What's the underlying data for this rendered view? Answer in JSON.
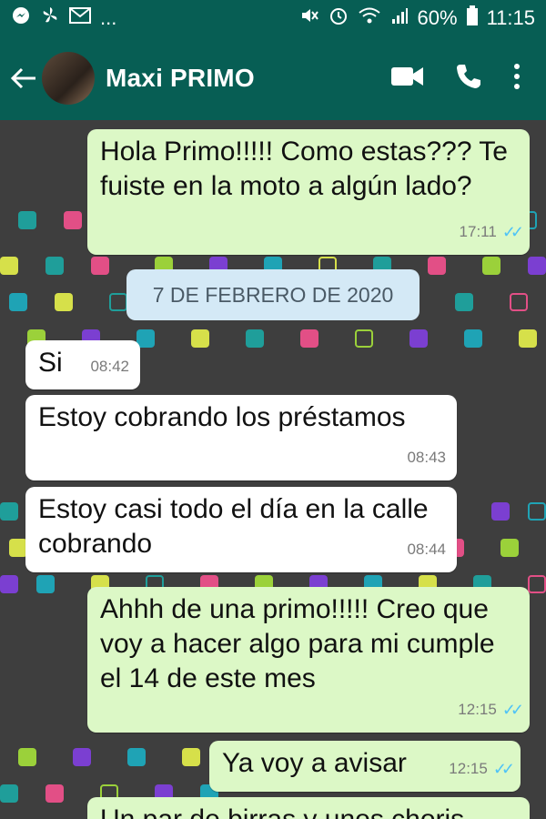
{
  "status_bar": {
    "battery": "60%",
    "clock": "11:15",
    "dots": "..."
  },
  "header": {
    "contact_name": "Maxi PRIMO"
  },
  "date_separator": "7 DE FEBRERO DE 2020",
  "messages": [
    {
      "dir": "out",
      "text": "Hola Primo!!!!! Como estas??? Te fuiste en la moto a algún lado?",
      "time": "17:11",
      "read": true
    },
    {
      "dir": "in",
      "text": "Si",
      "time": "08:42"
    },
    {
      "dir": "in",
      "text": "Estoy cobrando los préstamos",
      "time": "08:43"
    },
    {
      "dir": "in",
      "text": "Estoy casi todo el día en la calle cobrando",
      "time": "08:44"
    },
    {
      "dir": "out",
      "text": "Ahhh de una primo!!!!! Creo que voy a hacer algo para mi cumple el 14 de este mes",
      "time": "12:15",
      "read": true
    },
    {
      "dir": "out",
      "text": "Ya voy a avisar",
      "time": "12:15",
      "read": true
    },
    {
      "dir": "out",
      "text": "Un par de birras y unos choris",
      "time": "",
      "read": false
    }
  ],
  "colors": {
    "header": "#075e54",
    "outgoing_bubble": "#dcf8c6",
    "incoming_bubble": "#ffffff",
    "read_ticks": "#4fc3f7",
    "date_pill": "#d4e9f6"
  },
  "icons": [
    "messenger-icon",
    "fan-icon",
    "gmail-icon",
    "mute-icon",
    "alarm-icon",
    "wifi-icon",
    "signal-icon",
    "battery-icon",
    "back-arrow-icon",
    "video-call-icon",
    "phone-icon",
    "more-options-icon"
  ]
}
